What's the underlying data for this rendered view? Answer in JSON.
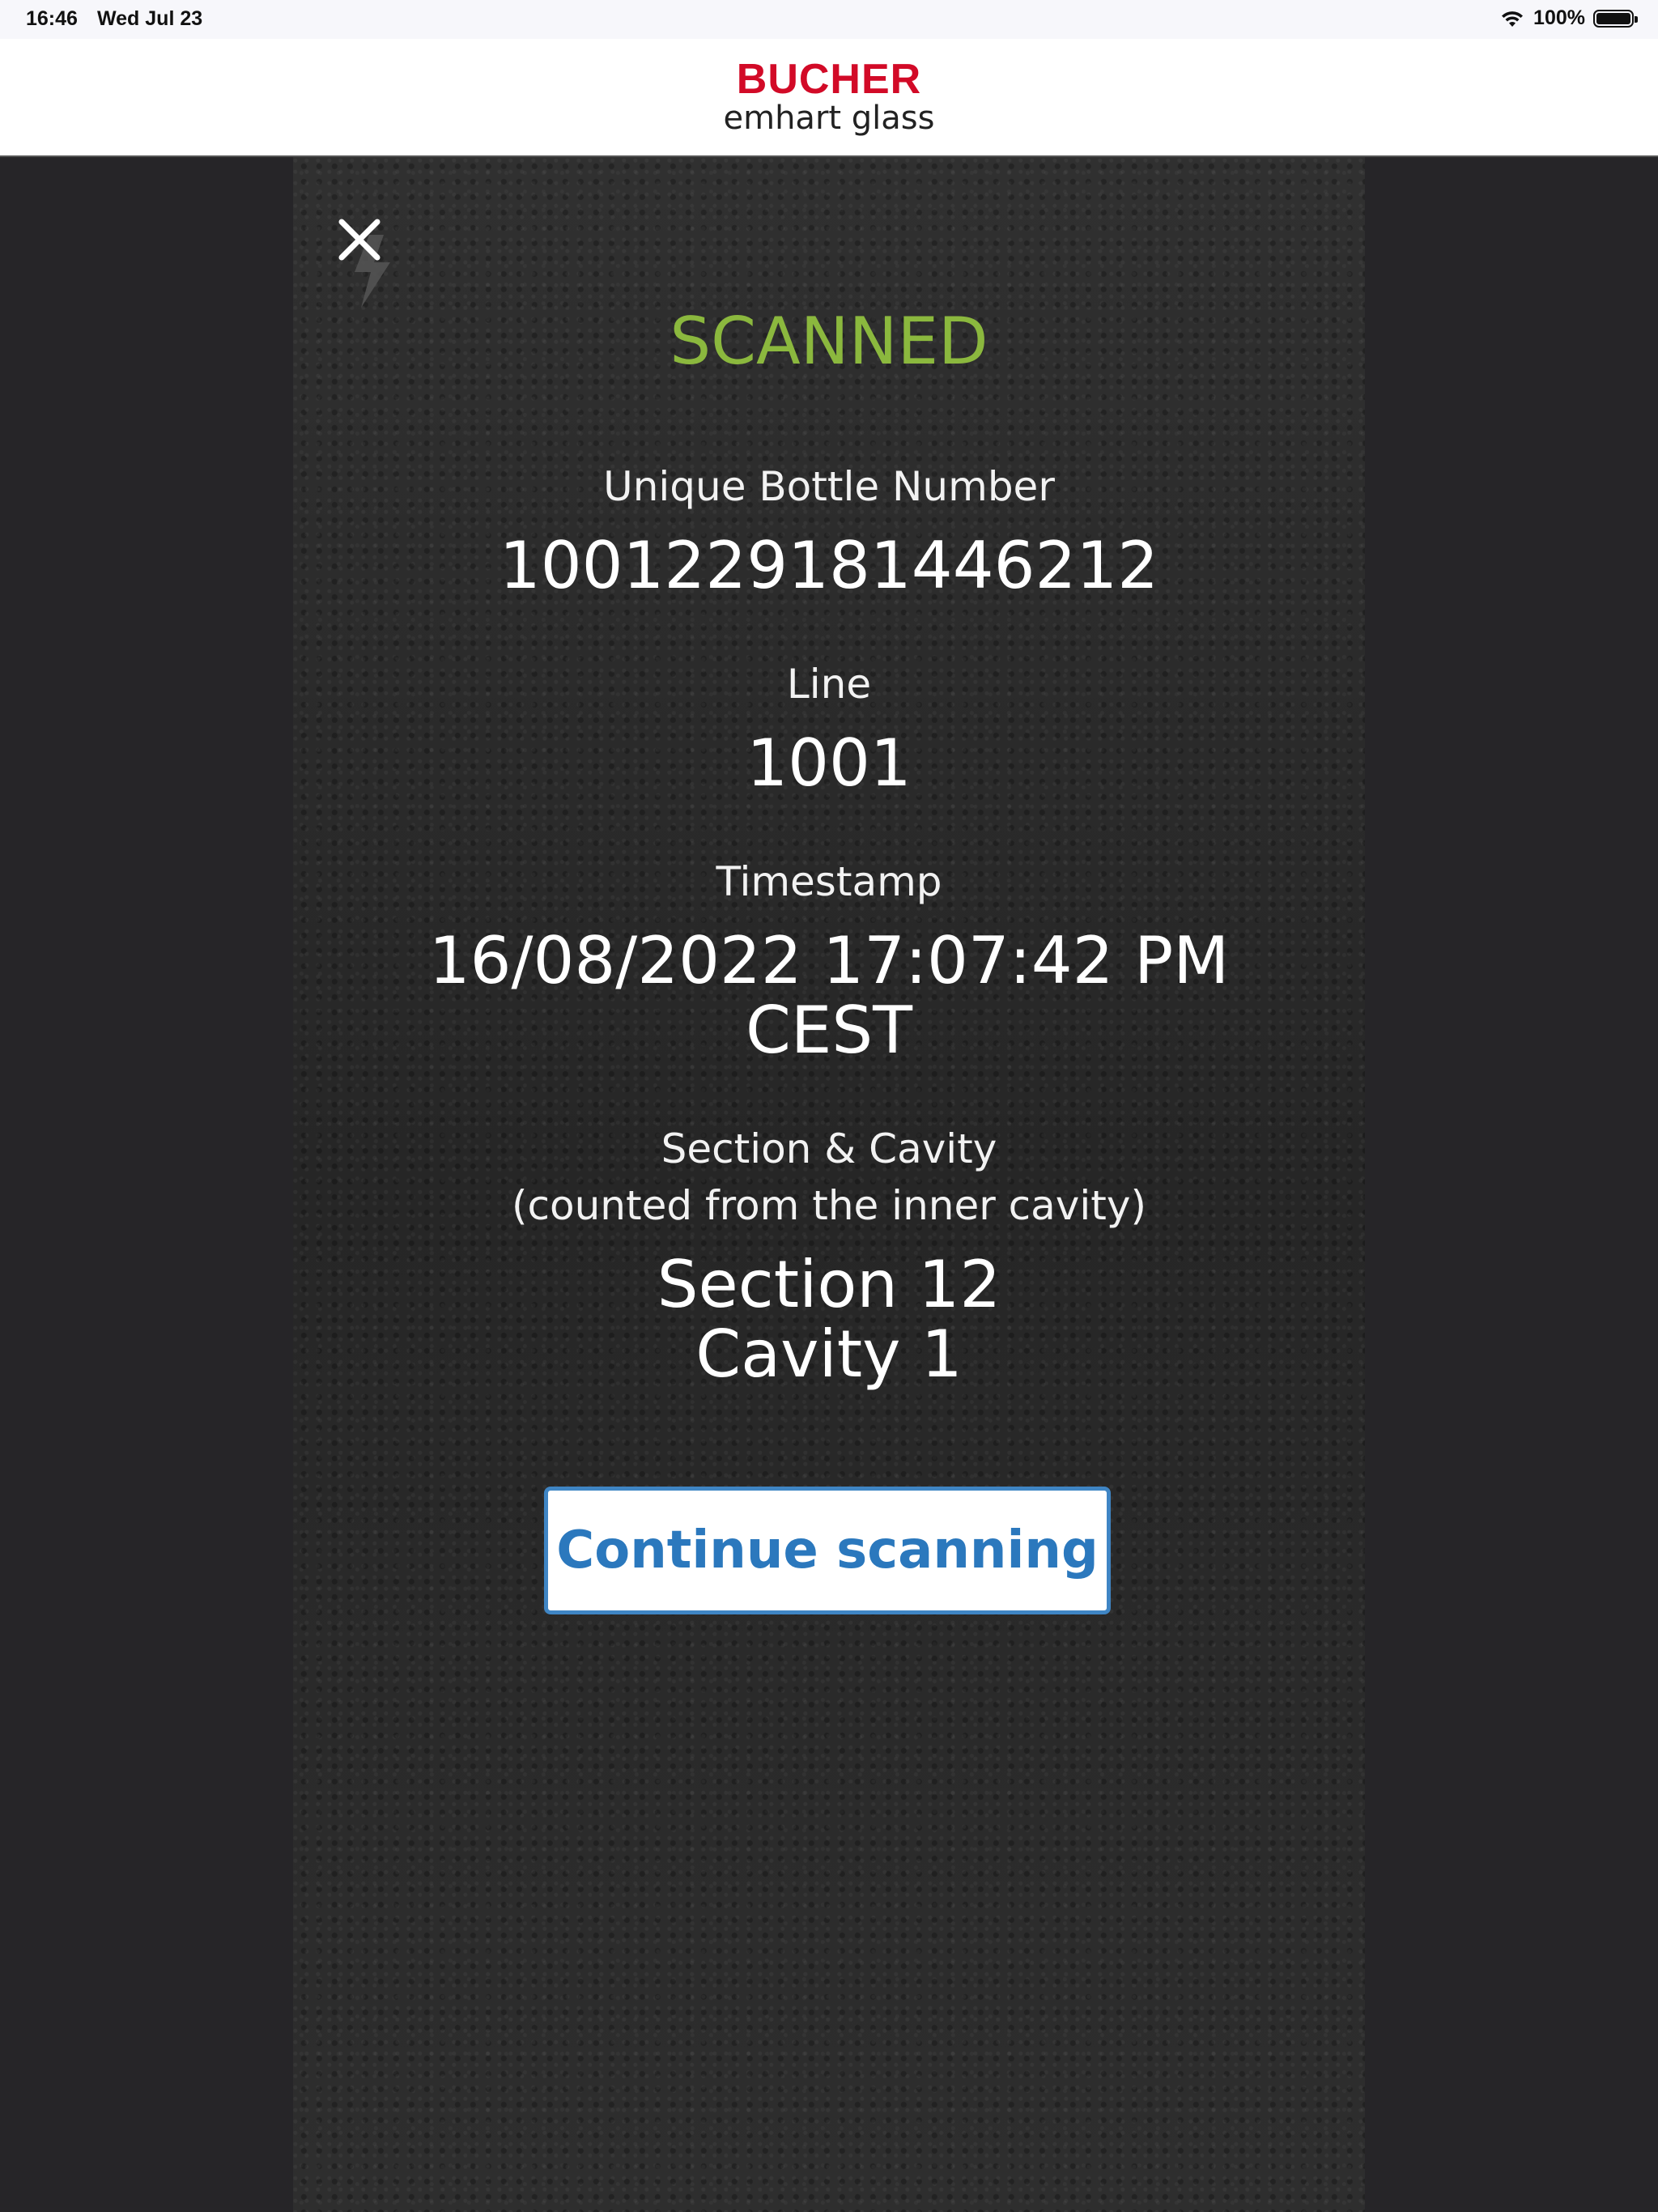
{
  "status_bar": {
    "time": "16:46",
    "date": "Wed Jul 23",
    "battery_text": "100%",
    "battery_level": 1.0,
    "icons": [
      "wifi-icon",
      "battery-icon"
    ]
  },
  "brand": {
    "primary": "BUCHER",
    "secondary": "emhart glass",
    "primary_color": "#d20a27"
  },
  "scanner": {
    "close_icon": "close-icon",
    "flash_icon": "flash-icon",
    "status_title": "SCANNED",
    "status_color": "#8bb83e",
    "fields": {
      "bottle_number": {
        "label": "Unique Bottle Number",
        "value": "1001229181446212"
      },
      "line": {
        "label": "Line",
        "value": "1001"
      },
      "timestamp": {
        "label": "Timestamp",
        "value_line1": "16/08/2022 17:07:42 PM",
        "value_line2": "CEST"
      },
      "section_cavity": {
        "label_line1": "Section & Cavity",
        "label_line2": "(counted from the inner cavity)",
        "value_line1": "Section 12",
        "value_line2": "Cavity 1"
      }
    },
    "continue_button": {
      "label": "Continue scanning",
      "color": "#2b78bd"
    }
  }
}
